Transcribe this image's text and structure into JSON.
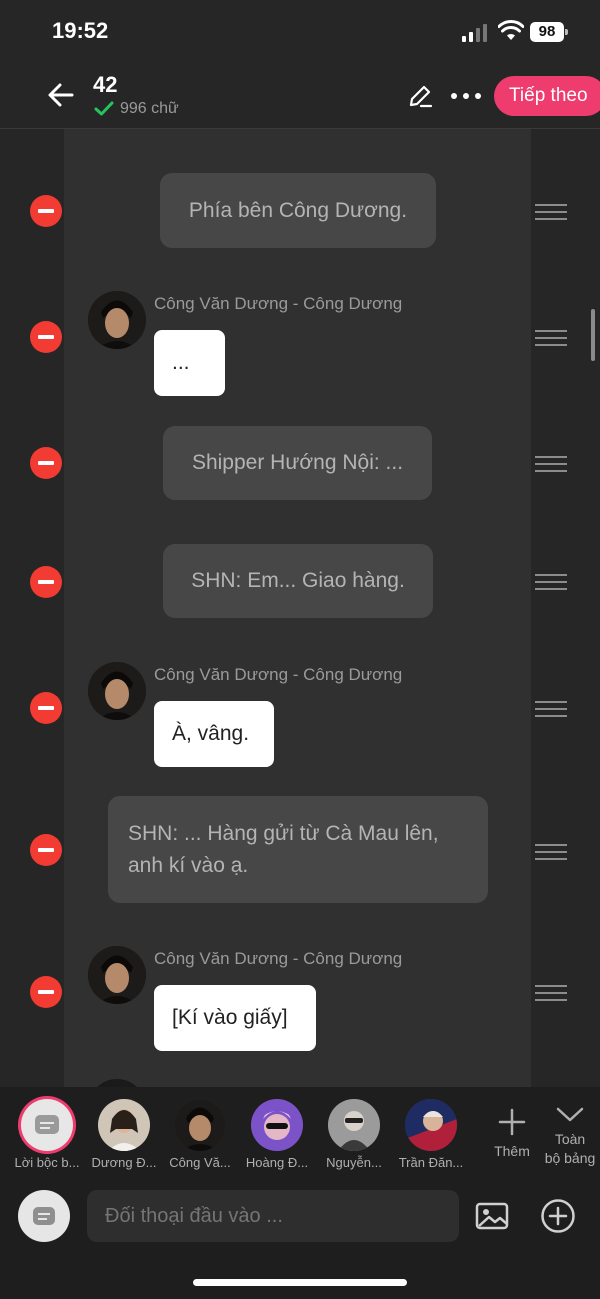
{
  "status_bar": {
    "time": "19:52",
    "battery": "98"
  },
  "header": {
    "title": "42",
    "word_count": "996 chữ",
    "next_label": "Tiếp theo"
  },
  "messages": [
    {
      "type": "narration",
      "text": "Phía bên Công Dương."
    },
    {
      "type": "character",
      "name": "Công Văn Dương - Công Dương",
      "text": "..."
    },
    {
      "type": "narration",
      "text": "Shipper Hướng Nội: ..."
    },
    {
      "type": "narration",
      "text": "SHN: Em... Giao hàng."
    },
    {
      "type": "character",
      "name": "Công Văn Dương - Công Dương",
      "text": "À, vâng."
    },
    {
      "type": "narration",
      "line1": "SHN: ... Hàng gửi từ Cà Mau lên,",
      "line2": "anh kí vào ạ."
    },
    {
      "type": "character",
      "name": "Công Văn Dương - Công Dương",
      "text": "[Kí vào giấy]"
    }
  ],
  "characters": [
    {
      "label": "Lời bộc b..."
    },
    {
      "label": "Dương Đ..."
    },
    {
      "label": "Công Vă..."
    },
    {
      "label": "Hoàng Đ..."
    },
    {
      "label": "Nguyễn..."
    },
    {
      "label": "Trần Đăn..."
    }
  ],
  "actions": {
    "add_label": "Thêm",
    "expand_line1": "Toàn",
    "expand_line2": "bộ bảng"
  },
  "composer": {
    "placeholder": "Đối thoại đầu vào ..."
  },
  "colors": {
    "accent": "#ef3c6e",
    "delete": "#f23b32",
    "narration_bg": "#474747",
    "bubble_bg": "#ffffff"
  }
}
